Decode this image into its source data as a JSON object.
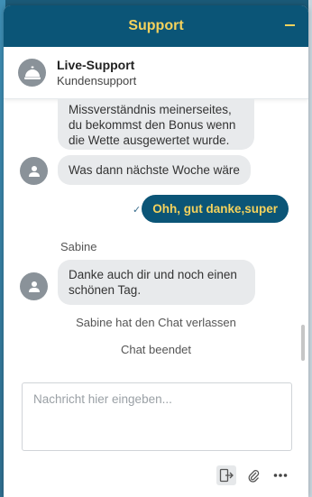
{
  "header": {
    "title": "Support"
  },
  "agent": {
    "name": "Live-Support",
    "role": "Kundensupport"
  },
  "messages": [
    {
      "type": "received",
      "text": "Missverständnis meinerseites, du bekommst den Bonus wenn die Wette ausgewertet wurde."
    },
    {
      "type": "received",
      "text": "Was dann nächste Woche wäre"
    },
    {
      "type": "sent",
      "text": "Ohh, gut danke,super",
      "status": "✓"
    },
    {
      "type": "sender",
      "text": "Sabine"
    },
    {
      "type": "received",
      "text": "Danke auch dir und noch einen schönen Tag."
    },
    {
      "type": "system",
      "text": "Sabine hat den Chat verlassen"
    },
    {
      "type": "system",
      "text": "Chat beendet"
    }
  ],
  "composer": {
    "placeholder": "Nachricht hier eingeben..."
  },
  "toolbar": {
    "icons": [
      "exit-chat-icon",
      "attachment-icon",
      "more-options-icon"
    ]
  },
  "colors": {
    "brand": "#0b5577",
    "accent": "#f5d25c",
    "bubble": "#e8eaec"
  }
}
